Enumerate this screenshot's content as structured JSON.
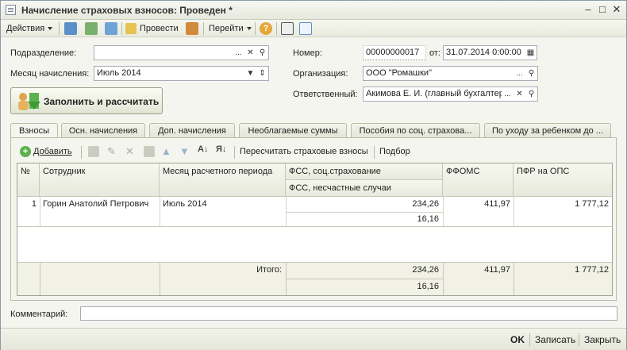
{
  "window": {
    "title": "Начисление страховых взносов: Проведен *"
  },
  "toolbar": {
    "actions_label": "Действия",
    "post_label": "Провести",
    "goto_label": "Перейти"
  },
  "form": {
    "subdivision_label": "Подразделение:",
    "subdivision_value": "",
    "month_label": "Месяц начисления:",
    "month_value": "Июль 2014",
    "number_label": "Номер:",
    "number_value": "00000000017",
    "date_label": "от:",
    "date_value": "31.07.2014  0:00:00",
    "org_label": "Организация:",
    "org_value": "ООО \"Ромашки\"",
    "resp_label": "Ответственный:",
    "resp_value": "Акимова Е. И. (главный бухгалтер)",
    "fill_button_label": "Заполнить и рассчитать"
  },
  "tabs": [
    "Взносы",
    "Осн. начисления",
    "Доп. начисления",
    "Необлагаемые суммы",
    "Пособия по соц. страхова...",
    "По уходу за ребенком до ..."
  ],
  "table_toolbar": {
    "add_label": "Добавить",
    "recalc_label": "Пересчитать страховые взносы",
    "select_label": "Подбор"
  },
  "table": {
    "headers": {
      "num": "№",
      "employee": "Сотрудник",
      "period": "Месяц расчетного периода",
      "fss": "ФСС, соц.страхование",
      "fss_ns": "ФСС, несчастные случаи",
      "ffoms": "ФФОМС",
      "pfr": "ПФР на ОПС"
    },
    "rows": [
      {
        "num": "1",
        "employee": "Горин Анатолий Петрович",
        "period": "Июль 2014",
        "fss": "234,26",
        "fss_ns": "16,16",
        "ffoms": "411,97",
        "pfr": "1 777,12"
      }
    ],
    "totals": {
      "label": "Итого:",
      "fss": "234,26",
      "fss_ns": "16,16",
      "ffoms": "411,97",
      "pfr": "1 777,12"
    }
  },
  "comment": {
    "label": "Комментарий:",
    "value": ""
  },
  "bottom": {
    "ok_label": "OK",
    "save_label": "Записать",
    "close_label": "Закрыть"
  }
}
